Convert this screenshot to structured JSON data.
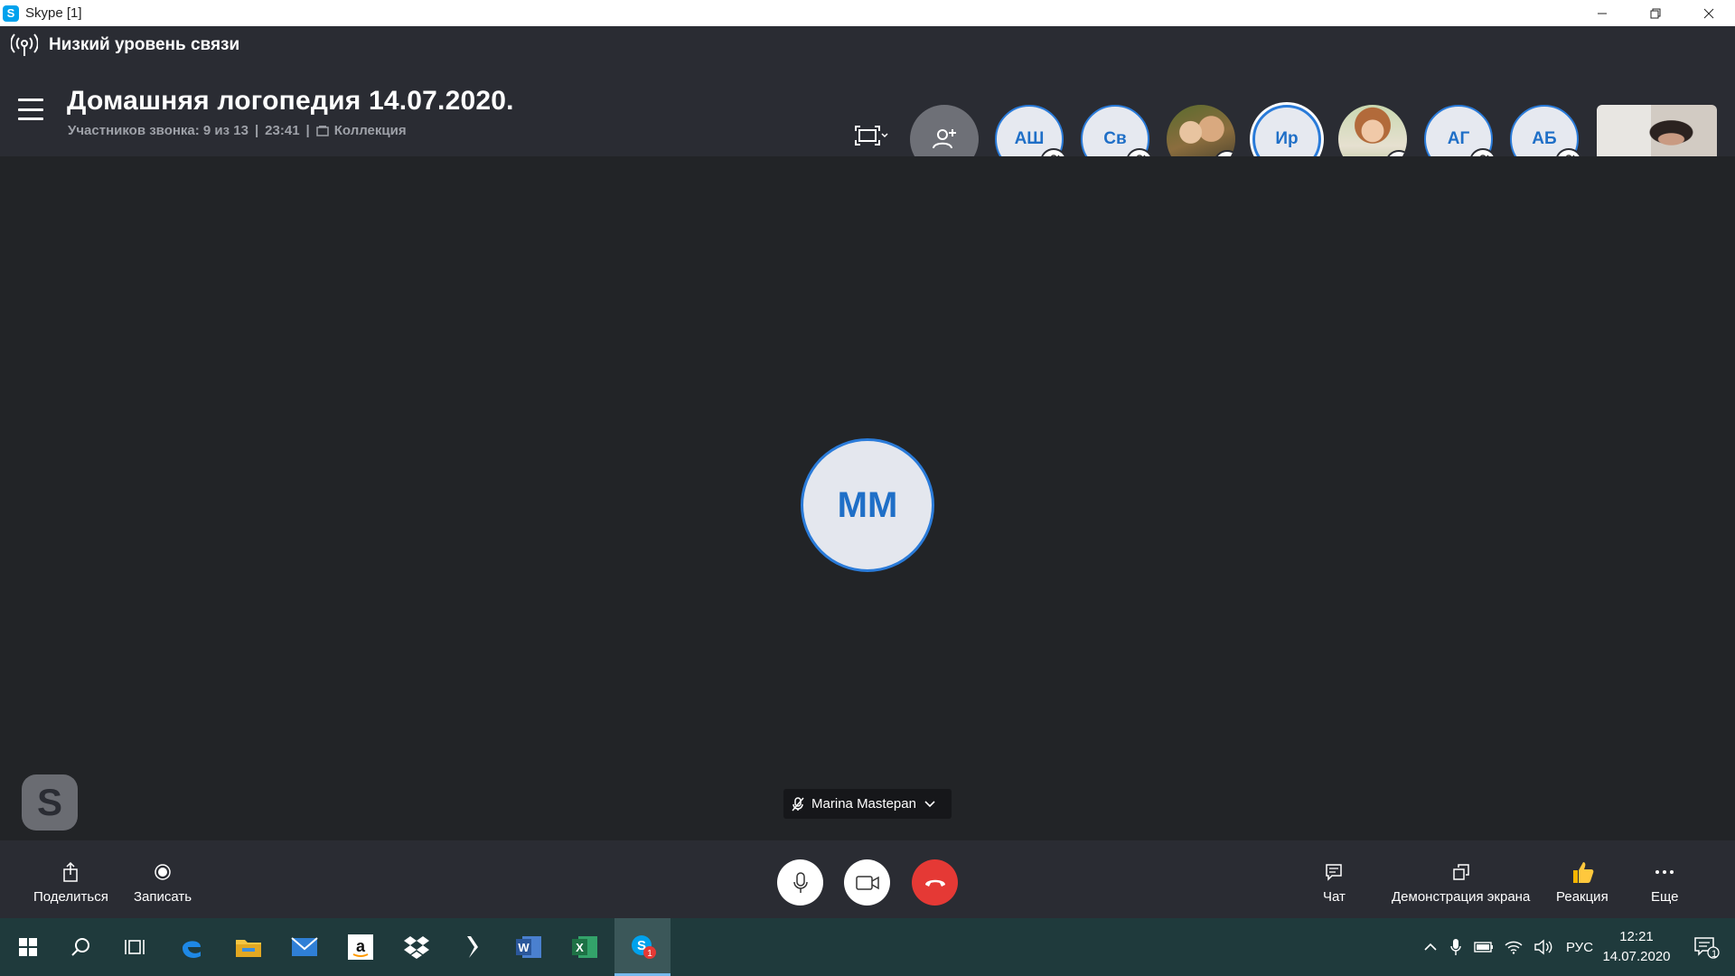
{
  "window": {
    "title": "Skype [1]"
  },
  "header": {
    "connection_quality": "Низкий уровень связи",
    "call_title": "Домашняя логопедия 14.07.2020.",
    "participants_text": "Участников звонка: 9 из 13",
    "duration": "23:41",
    "separator": "|",
    "gallery_label": "Коллекция"
  },
  "participants": [
    {
      "initials": "АШ",
      "muted": true
    },
    {
      "initials": "Св",
      "muted": true
    },
    {
      "initials": "",
      "photo": true,
      "muted": true
    },
    {
      "initials": "Ир",
      "muted": false,
      "active": true
    },
    {
      "initials": "",
      "photo": true,
      "muted": true
    },
    {
      "initials": "АГ",
      "muted": true
    },
    {
      "initials": "АБ",
      "muted": true
    }
  ],
  "main_speaker": {
    "initials": "MM",
    "name": "Marina Mastepan"
  },
  "controls": {
    "share_label": "Поделиться",
    "record_label": "Записать",
    "chat_label": "Чат",
    "screen_share_label": "Демонстрация экрана",
    "reaction_label": "Реакция",
    "more_label": "Еще"
  },
  "taskbar": {
    "language": "РУС",
    "time": "12:21",
    "date": "14.07.2020",
    "notification_count": "1",
    "skype_badge": "1"
  },
  "colors": {
    "accent": "#2a7bd9",
    "end_call": "#e53935",
    "header_bg": "#2a2c33",
    "stage_bg": "#222427"
  }
}
